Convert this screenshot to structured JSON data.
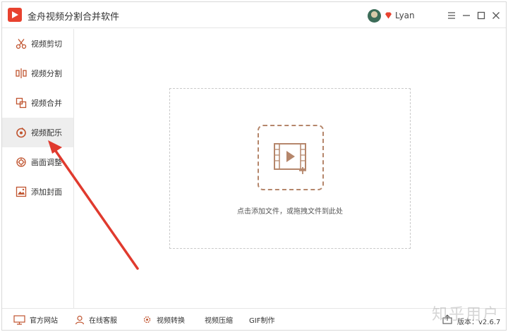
{
  "app": {
    "title": "金舟视频分割合并软件",
    "username": "Lyan"
  },
  "sidebar": {
    "items": [
      {
        "label": "视频剪切",
        "icon": "scissors-icon"
      },
      {
        "label": "视频分割",
        "icon": "split-icon"
      },
      {
        "label": "视频合并",
        "icon": "merge-icon"
      },
      {
        "label": "视频配乐",
        "icon": "music-icon",
        "active": true
      },
      {
        "label": "画面调整",
        "icon": "adjust-icon"
      },
      {
        "label": "添加封面",
        "icon": "cover-icon"
      }
    ]
  },
  "main": {
    "drop_hint": "点击添加文件，或拖拽文件到此处"
  },
  "footer": {
    "website": "官方网站",
    "support": "在线客服",
    "convert": "视频转换",
    "compress": "视频压缩",
    "gif": "GIF制作",
    "version": "版本：v2.6.7"
  },
  "watermark": "知乎用户",
  "colors": {
    "accent": "#b5866b",
    "brand": "#e8422f",
    "arrow": "#e03a2e"
  }
}
